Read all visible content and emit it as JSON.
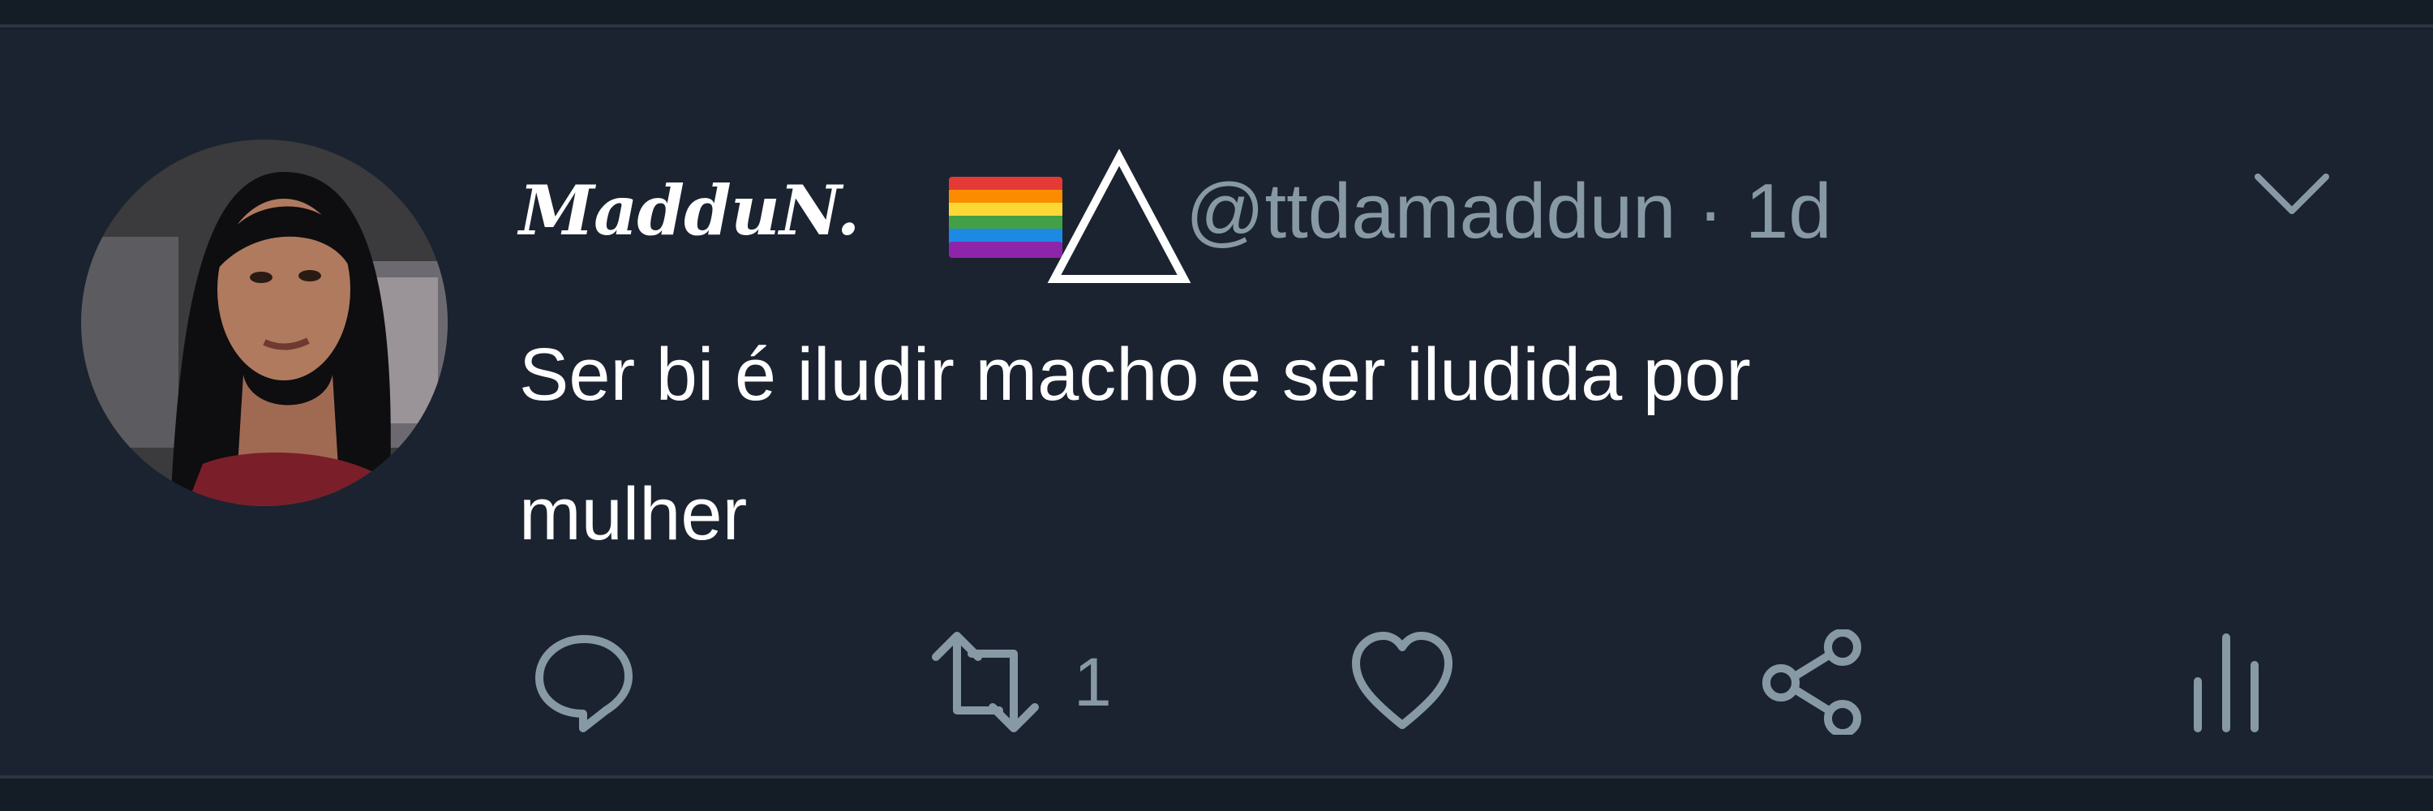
{
  "tweet": {
    "author": {
      "display_name": "MadduN.",
      "name_emoji": [
        "rainbow-flag-icon",
        "triangle-icon"
      ],
      "handle": "@ttdamaddun",
      "separator": "·",
      "time": "1d"
    },
    "text": "Ser bi é iludir macho e ser iludida por\nmulher",
    "actions": {
      "reply": {
        "icon": "reply-icon",
        "count": ""
      },
      "retweet": {
        "icon": "retweet-icon",
        "count": "1"
      },
      "like": {
        "icon": "heart-icon",
        "count": ""
      },
      "share": {
        "icon": "share-icon",
        "count": ""
      },
      "analytics": {
        "icon": "analytics-icon",
        "count": ""
      }
    }
  },
  "colors": {
    "background": "#1b2330",
    "text": "#ffffff",
    "muted": "#8899a6",
    "divider": "#2b3543"
  }
}
